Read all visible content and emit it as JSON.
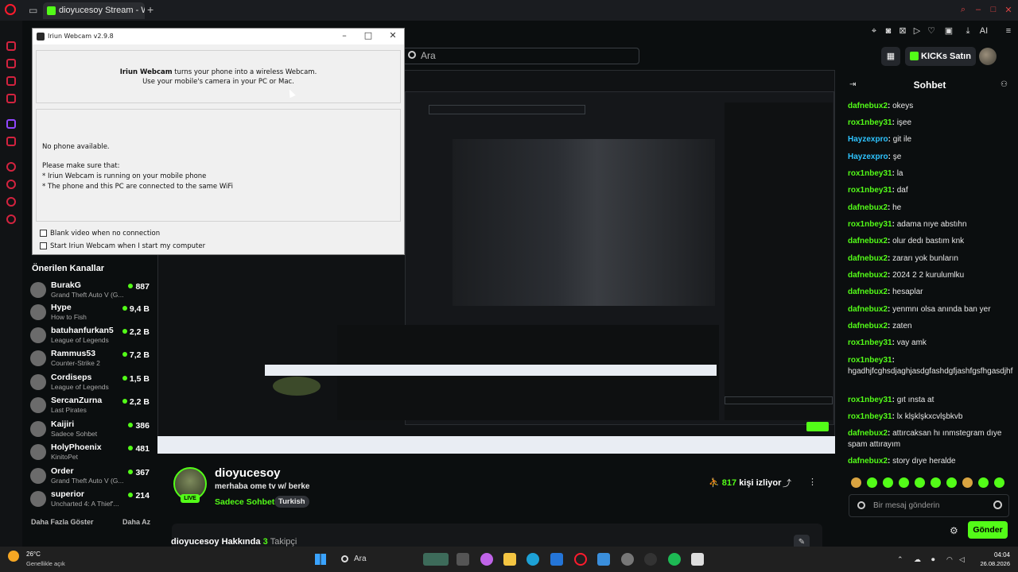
{
  "browser": {
    "tab_title": "dioyucesoy Stream - Watch",
    "new_tab": "+",
    "toolbar_icons": [
      "pin-icon",
      "camera-icon",
      "close-box-icon",
      "play-icon",
      "heart-icon",
      "box-icon",
      "download-icon",
      "ai-icon",
      "menu-icon"
    ],
    "ai_label": "AI"
  },
  "header": {
    "search_placeholder": "Ara",
    "kicks_button": "KICKs Satın Al"
  },
  "sidebar": {
    "title": "Önerilen Kanallar",
    "channels": [
      {
        "name": "BurakG",
        "game": "Grand Theft Auto V (G...",
        "viewers": "887"
      },
      {
        "name": "Hype",
        "game": "How to Fish",
        "viewers": "9,4 B"
      },
      {
        "name": "batuhanfurkan5",
        "game": "League of Legends",
        "viewers": "2,2 B"
      },
      {
        "name": "Rammus53",
        "game": "Counter-Strike 2",
        "viewers": "7,2 B"
      },
      {
        "name": "Cordiseps",
        "game": "League of Legends",
        "viewers": "1,5 B"
      },
      {
        "name": "SercanZurna",
        "game": "Last Pirates",
        "viewers": "2,2 B"
      },
      {
        "name": "Kaijiri",
        "game": "Sadece Sohbet",
        "viewers": "386"
      },
      {
        "name": "HolyPhoenix",
        "game": "KinitoPet",
        "viewers": "481"
      },
      {
        "name": "Order",
        "game": "Grand Theft Auto V (G...",
        "viewers": "367"
      },
      {
        "name": "superior",
        "game": "Uncharted 4: A Thief'...",
        "viewers": "214"
      }
    ],
    "show_more": "Daha Fazla Göster",
    "show_less": "Daha Az"
  },
  "channel": {
    "name": "dioyucesoy",
    "subtitle": "merhaba ome tv w/ berke",
    "category": "Sadece Sohbet",
    "tag": "Turkish",
    "live": "LIVE",
    "viewers_count": "817",
    "viewers_label": "kişi izliyor",
    "about_title": "dioyucesoy Hakkında",
    "followers_count": "3",
    "followers_label": "Takipçi"
  },
  "chat": {
    "title": "Sohbet",
    "messages": [
      {
        "user": "dafnebux2",
        "color": "#53fc18",
        "text": "okeys"
      },
      {
        "user": "rox1nbey31",
        "color": "#53fc18",
        "text": "işee"
      },
      {
        "user": "Hayzexpro",
        "color": "#2ec4ff",
        "text": "git ile"
      },
      {
        "user": "Hayzexpro",
        "color": "#2ec4ff",
        "text": "şe"
      },
      {
        "user": "rox1nbey31",
        "color": "#53fc18",
        "text": "la"
      },
      {
        "user": "rox1nbey31",
        "color": "#53fc18",
        "text": "daf"
      },
      {
        "user": "dafnebux2",
        "color": "#53fc18",
        "text": "he"
      },
      {
        "user": "rox1nbey31",
        "color": "#53fc18",
        "text": "adama nıye abstıhn"
      },
      {
        "user": "dafnebux2",
        "color": "#53fc18",
        "text": "olur dedı bastım knk"
      },
      {
        "user": "dafnebux2",
        "color": "#53fc18",
        "text": "zararı yok bunların"
      },
      {
        "user": "dafnebux2",
        "color": "#53fc18",
        "text": "2024 2 2 kurulumlku"
      },
      {
        "user": "dafnebux2",
        "color": "#53fc18",
        "text": "hesaplar"
      },
      {
        "user": "dafnebux2",
        "color": "#53fc18",
        "text": "yenmnı olsa anında ban yer"
      },
      {
        "user": "dafnebux2",
        "color": "#53fc18",
        "text": "zaten"
      },
      {
        "user": "rox1nbey31",
        "color": "#53fc18",
        "text": "vay amk"
      },
      {
        "user": "rox1nbey31",
        "color": "#53fc18",
        "text": "hgadhjfcghsdjaghjasdgfashdgfjashfgsfhgasdjhf"
      },
      {
        "user": "rox1nbey31",
        "color": "#53fc18",
        "text": "gıt ınsta at"
      },
      {
        "user": "rox1nbey31",
        "color": "#53fc18",
        "text": "lx klşklşkxcvlşbkvb"
      },
      {
        "user": "dafnebux2",
        "color": "#53fc18",
        "text": "attırcaksan hı ınmstegram dıye spam attırayım"
      },
      {
        "user": "dafnebux2",
        "color": "#53fc18",
        "text": "story dıye heralde"
      }
    ],
    "input_placeholder": "Bir mesaj gönderin",
    "send_label": "Gönder"
  },
  "dialog": {
    "title": "Iriun Webcam v2.9.8",
    "headline_bold": "Iriun Webcam",
    "headline_rest": " turns your phone into a wireless Webcam.",
    "headline2": "Use your mobile's camera in your PC or Mac.",
    "status": "No phone available.",
    "tips_title": "Please make sure that:",
    "tip1": "* Iriun Webcam is running on your mobile phone",
    "tip2": "* The phone and this PC are connected to the same WiFi",
    "opt1": "Blank video when no connection",
    "opt2": "Start Iriun Webcam when I start my computer"
  },
  "taskbar": {
    "weather_temp": "26°C",
    "weather_desc": "Genellikle açık",
    "search": "Ara",
    "time": "04:04",
    "date": "26.08.2026"
  },
  "colors": {
    "accent": "#53fc18",
    "opera_red": "#ff1b2d",
    "mention_blue": "#2ec4ff"
  }
}
